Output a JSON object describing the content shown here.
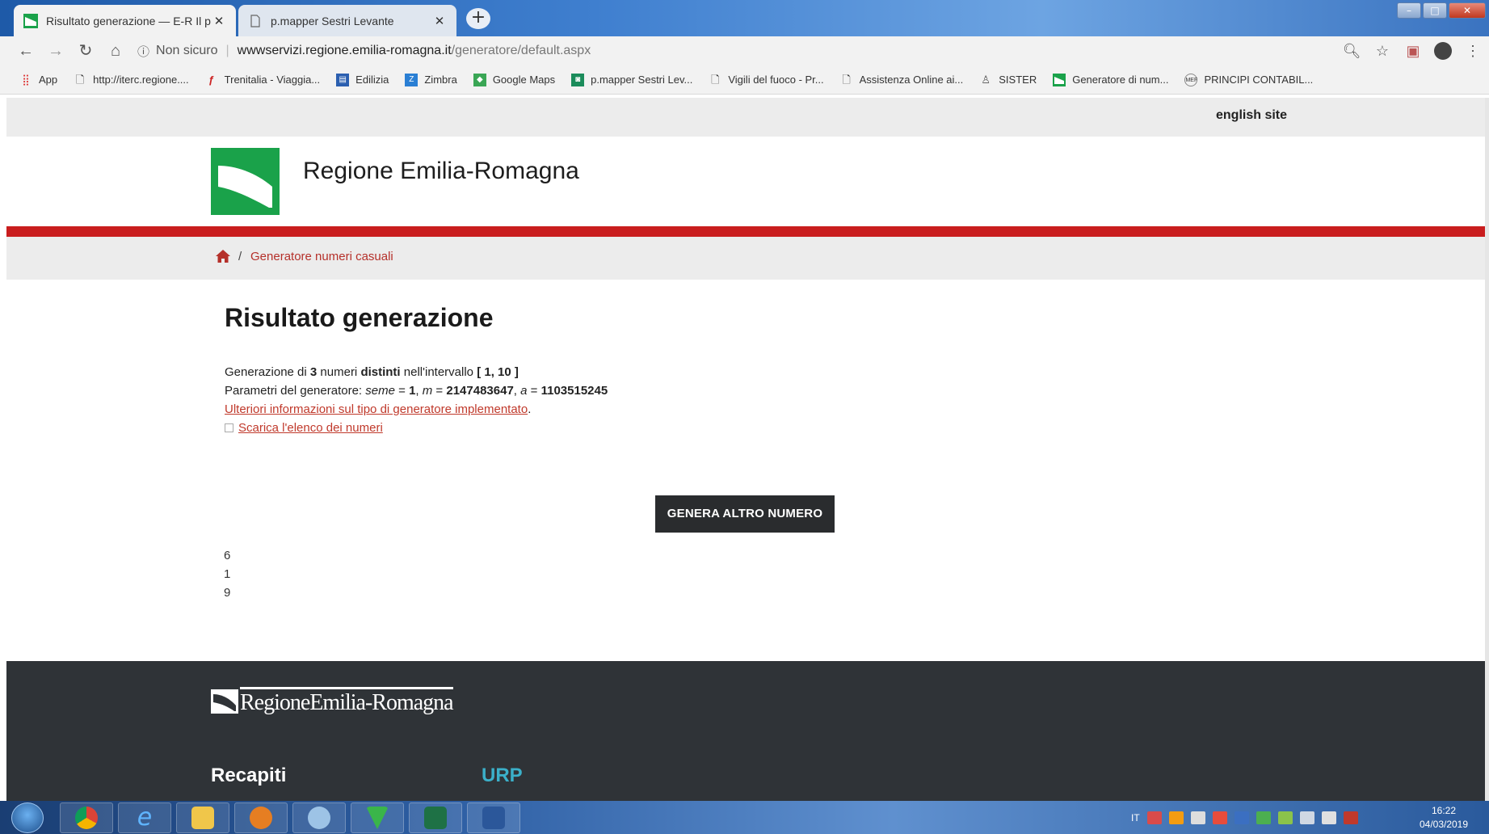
{
  "browser": {
    "tabs": [
      {
        "title": "Risultato generazione — E-R Il p",
        "active": true
      },
      {
        "title": "p.mapper Sestri Levante",
        "active": false
      }
    ],
    "new_tab_glyph": "+",
    "address": {
      "security_label": "Non sicuro",
      "host": "wwwservizi.regione.emilia-romagna.it",
      "path": "/generatore/default.aspx"
    },
    "bookmarks": [
      {
        "label": "App",
        "icon": "apps-grid-icon"
      },
      {
        "label": "http://iterc.regione....",
        "icon": "page-icon"
      },
      {
        "label": "Trenitalia - Viaggia...",
        "icon": "trenitalia-icon"
      },
      {
        "label": "Edilizia",
        "icon": "edilizia-icon"
      },
      {
        "label": "Zimbra",
        "icon": "zimbra-icon"
      },
      {
        "label": "Google Maps",
        "icon": "google-maps-icon"
      },
      {
        "label": "p.mapper Sestri Lev...",
        "icon": "pmapper-icon"
      },
      {
        "label": "Vigili del fuoco - Pr...",
        "icon": "page-icon"
      },
      {
        "label": "Assistenza Online ai...",
        "icon": "page-icon"
      },
      {
        "label": "SISTER",
        "icon": "sister-icon"
      },
      {
        "label": "Generatore di num...",
        "icon": "regione-flag-icon"
      },
      {
        "label": "PRINCIPI CONTABIL...",
        "icon": "mef-icon"
      }
    ]
  },
  "page": {
    "english_site": "english site",
    "site_title": "Regione Emilia-Romagna",
    "breadcrumb": {
      "separator": "/",
      "current": "Generatore numeri casuali"
    },
    "heading": "Risultato generazione",
    "line1": {
      "t1": "Generazione di ",
      "count": "3",
      "t2": " numeri ",
      "distinct": "distinti",
      "t3": " nell'intervallo ",
      "range": "[ 1, 10 ]"
    },
    "line2": {
      "t1": "Parametri del generatore: ",
      "seed_label": "seme",
      "eq1": " = ",
      "seed": "1",
      "c1": ", ",
      "m_label": "m",
      "eq2": " = ",
      "m": "2147483647",
      "c2": ", ",
      "a_label": "a",
      "eq3": " = ",
      "a": "1103515245"
    },
    "more_info_link": "Ulteriori informazioni sul tipo di generatore implementato",
    "more_info_tail": ".",
    "download_link": "Scarica l'elenco dei numeri",
    "generate_button": "GENERA ALTRO NUMERO",
    "numbers": [
      "6",
      "1",
      "9"
    ],
    "footer": {
      "logo_text": "RegioneEmilia-Romagna",
      "col1_heading": "Recapiti",
      "col2_heading": "URP"
    }
  },
  "taskbar": {
    "language": "IT",
    "time": "16:22",
    "date": "04/03/2019"
  },
  "colors": {
    "accent_red": "#c91d1e",
    "link_red": "#c0392b",
    "brand_green": "#1aa24a",
    "button_dark": "#2a2c2e",
    "footer_dark": "#2f3337",
    "urp_teal": "#3bb0c9"
  }
}
